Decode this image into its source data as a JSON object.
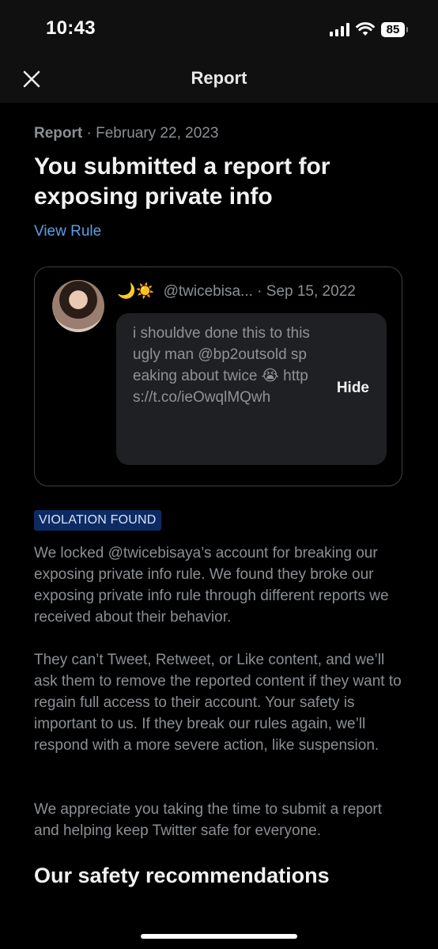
{
  "status_bar": {
    "time": "10:43",
    "battery": "85"
  },
  "nav": {
    "title": "Report"
  },
  "report": {
    "type": "Report",
    "separator": "·",
    "date": "February 22, 2023",
    "headline": "You submitted a report for exposing private info",
    "view_rule": "View Rule"
  },
  "tweet": {
    "emojis": "🌙☀️",
    "handle": "@twicebisa...",
    "separator": "·",
    "date": "Sep 15, 2022",
    "text": "i shouldve done this to this ugly man @bp2outsold speaking about twice 😭 https://t.co/ieOwqlMQwh",
    "hide_label": "Hide"
  },
  "violation_badge": "VIOLATION FOUND",
  "paragraphs": [
    "We locked @twicebisaya’s account for breaking our exposing private info rule. We found they broke our exposing private info rule through different reports we received about their behavior.",
    "They can’t Tweet, Retweet, or Like content, and we’ll ask them to remove the reported content if they want to regain full access to their account. Your safety is important to us. If they break our rules again, we’ll respond with a more severe action, like suspension.",
    "We appreciate you taking the time to submit a report and helping keep Twitter safe for everyone."
  ],
  "section_heading": "Our safety recommendations",
  "colors": {
    "background": "#000000",
    "link": "#5b9fe6",
    "badge_bg": "#0d2b62",
    "muted_text": "#8b8f94"
  },
  "icons": {
    "close": "close-icon",
    "signal": "cellular-signal-icon",
    "wifi": "wifi-icon",
    "battery": "battery-icon"
  }
}
